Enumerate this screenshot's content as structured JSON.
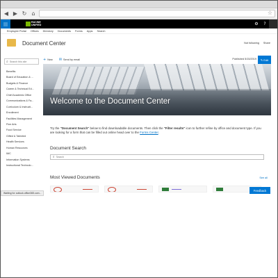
{
  "browser": {
    "nav": {
      "back": "◀",
      "forward": "▶",
      "reload": "↻",
      "home": "⌂"
    },
    "star_icon": "☆",
    "status_text": "Waiting for outlook.office365.com..."
  },
  "suite_bar": {
    "brand_line1": "RACINE",
    "brand_line2": "UNIFIED",
    "icons": {
      "gear": "⚙",
      "help": "?"
    }
  },
  "top_nav": {
    "items": [
      "Employee Portal",
      "Offices",
      "Directory",
      "Documents",
      "Forms",
      "Apps",
      "Search"
    ]
  },
  "site": {
    "title": "Document Center",
    "actions": {
      "not_following": "Not following",
      "share": "Share"
    }
  },
  "left_nav": {
    "search_placeholder": "Search this site",
    "items": [
      "Benefits",
      "Board of Education & ...",
      "Budgets & Finance",
      "Career & Technical Ed...",
      "Chief Academic Office",
      "Communications & Fa...",
      "Curriculum & Instructi...",
      "Enrollment",
      "Facilities Management",
      "Fine Arts",
      "Food Service",
      "Gifted & Talented",
      "Health Services",
      "Human Resources",
      "IMC",
      "Information Systems",
      "Instructional Technolo..."
    ]
  },
  "command_bar": {
    "new_label": "New",
    "send_label": "Send by email",
    "published": "Published 5/15/2019",
    "edit_label": "Edit"
  },
  "hero": {
    "title": "Welcome to the Document Center"
  },
  "intro": {
    "p1_a": "Try the ",
    "p1_b": "\"Document Search\"",
    "p1_c": " below to find downloadable documents. Then click the ",
    "p1_d": "\"Filter results\"",
    "p1_e": " icon to further refine by office and document type.  If you are looking for a form that can be filled out online head over to the ",
    "link": "Forms Center",
    "p1_f": "."
  },
  "doc_search": {
    "title": "Document Search",
    "placeholder": "Search"
  },
  "most_viewed": {
    "title": "Most Viewed Documents",
    "see_all": "See all"
  },
  "feedback": {
    "label": "Feedback"
  },
  "colors": {
    "accent": "#0072c6",
    "edit_button": "#0078d4",
    "brand_green": "#7ab800"
  }
}
